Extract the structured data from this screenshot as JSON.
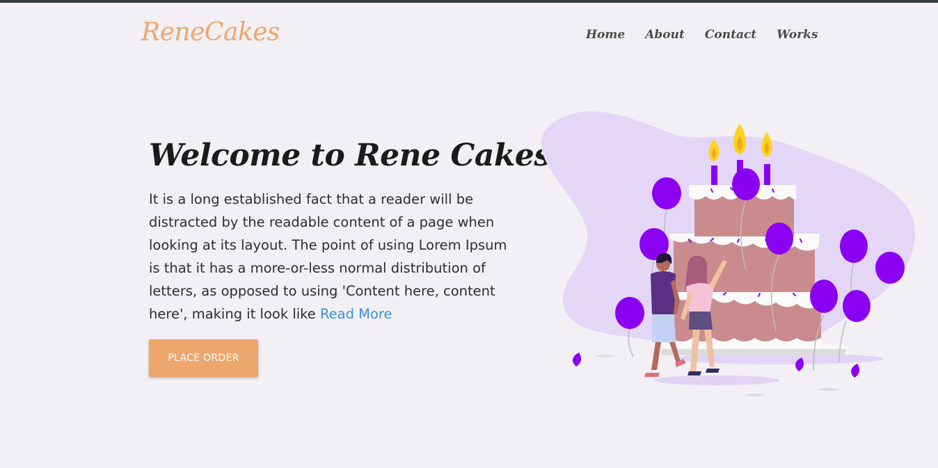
{
  "brand": {
    "logo_text": "ReneCakes"
  },
  "nav": {
    "items": [
      {
        "label": "Home"
      },
      {
        "label": "About"
      },
      {
        "label": "Contact"
      },
      {
        "label": "Works"
      }
    ]
  },
  "hero": {
    "title": "Welcome to Rene Cakes",
    "paragraph": "It is a long established fact that a reader will be distracted by the readable content of a page when looking at its layout. The point of using Lorem Ipsum is that it has a more-or-less normal distribution of letters, as opposed to using 'Content here, content here', making it look like",
    "read_more": "Read More",
    "cta_label": "PLACE ORDER"
  },
  "colors": {
    "accent": "#eda66b",
    "link": "#3e8fdc",
    "background": "#f3f0f5",
    "balloon": "#8b00f0",
    "cake": "#c98b8d"
  },
  "illustration": {
    "icon": "birthday-cake-illustration"
  }
}
